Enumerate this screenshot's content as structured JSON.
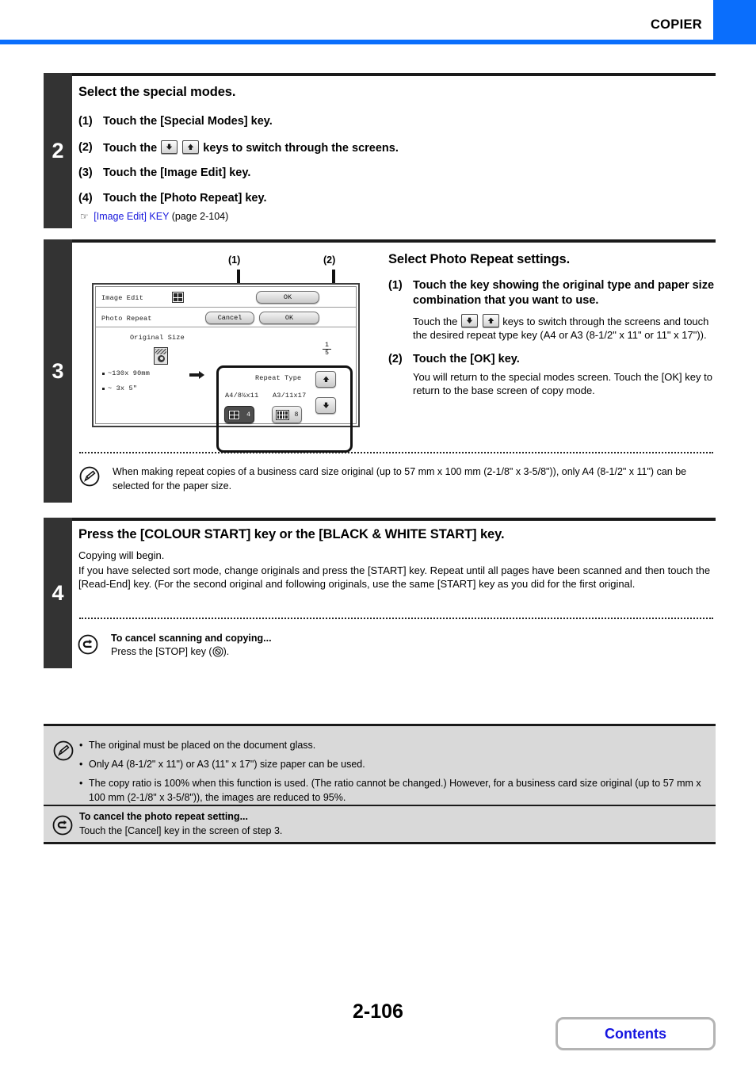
{
  "header": {
    "title": "COPIER",
    "accent_color": "#0a6efc"
  },
  "steps": [
    {
      "number": "2",
      "title": "Select the special modes.",
      "substeps": [
        {
          "num": "(1)",
          "text": "Touch the [Special Modes] key."
        },
        {
          "num": "(2)",
          "text_before": "Touch the",
          "keys": [
            "down-arrow-key",
            "up-arrow-key"
          ],
          "text_after": "keys to switch through the screens."
        },
        {
          "num": "(3)",
          "text": "Touch the [Image Edit] key."
        },
        {
          "num": "(4)",
          "text": "Touch the [Photo Repeat] key."
        }
      ],
      "reference": {
        "icon": "pointing-hand-icon",
        "link_text": "[Image Edit] KEY",
        "page_text": "(page 2-104)"
      }
    },
    {
      "number": "3",
      "title": "Select Photo Repeat settings.",
      "substeps": [
        {
          "num": "(1)",
          "text": "Touch the key showing the original type and paper size combination that you want to use.",
          "detail_before": "Touch the",
          "detail_after": "keys to switch through the screens and touch the desired repeat type key (A4 or A3 (8-1/2\" x 11\" or 11\" x 17\"))."
        },
        {
          "num": "(2)",
          "text": "Touch the [OK] key.",
          "detail": "You will return to the special modes screen. Touch the [OK] key to return to the base screen of copy mode."
        }
      ],
      "callouts": [
        "(1)",
        "(2)"
      ],
      "note": {
        "icon": "pencil-note-icon",
        "text": "When making repeat copies of a business card size original (up to 57 mm x 100 mm (2-1/8\" x 3-5/8\")), only A4 (8-1/2\" x 11\") can be selected for the paper size."
      }
    },
    {
      "number": "4",
      "title": "Press the [COLOUR START] key or the [BLACK & WHITE START] key.",
      "body_lines": [
        "Copying will begin.",
        "If you have selected sort mode, change originals and press the [START] key. Repeat until all pages have been scanned and then touch the [Read-End] key. (For the second original and following originals, use the same [START] key as you did for the first original."
      ],
      "cancel_note": {
        "icon": "undo-arrow-icon",
        "title": "To cancel scanning and copying...",
        "text_before": "Press the [STOP] key (",
        "stop_icon": "stop-key-icon",
        "text_after": ")."
      }
    }
  ],
  "lcd": {
    "title_bar_label": "Image Edit",
    "title_bar_icon": "grid-4-icon",
    "title_bar_ok": "OK",
    "second_bar_label": "Photo Repeat",
    "second_bar_cancel": "Cancel",
    "second_bar_ok": "OK",
    "original_size_label": "Original Size",
    "original_icon": "photo-original-icon",
    "original_sizes": [
      "~130x 90mm",
      "~ 3x 5\""
    ],
    "arrow_icon": "right-arrow-icon",
    "repeat_type_label": "Repeat Type",
    "page_indicator": {
      "current": "1",
      "total": "5"
    },
    "repeat_types": [
      {
        "label": "A4/8½x11",
        "count": "4",
        "selected": true,
        "icon": "grid-4-icon"
      },
      {
        "label": "A3/11x17",
        "count": "8",
        "selected": false,
        "icon": "grid-8-icon"
      }
    ],
    "scroll_up": "up-arrow-key",
    "scroll_down": "down-arrow-key"
  },
  "bottom_notes": {
    "icon": "pencil-note-icon",
    "bullets": [
      "The original must be placed on the document glass.",
      "Only A4 (8-1/2\" x 11\") or A3 (11\" x 17\") size paper can be used.",
      "The copy ratio is 100% when this function is used. (The ratio cannot be changed.) However, for a business card size original (up to 57 mm x 100 mm (2-1/8\" x 3-5/8\")), the images are reduced to 95%."
    ],
    "cancel": {
      "icon": "undo-arrow-icon",
      "title": "To cancel the photo repeat setting...",
      "text": "Touch the [Cancel] key in the screen of step 3."
    }
  },
  "footer": {
    "page_number": "2-106",
    "contents_label": "Contents"
  }
}
